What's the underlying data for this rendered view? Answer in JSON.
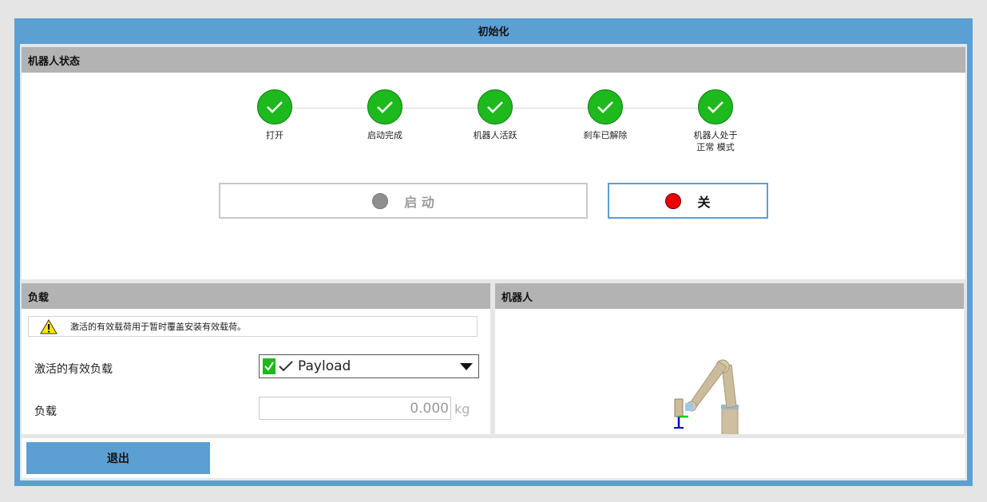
{
  "window": {
    "title": "初始化"
  },
  "robot_status": {
    "header": "机器人状态",
    "steps": [
      {
        "label": "打开"
      },
      {
        "label": "启动完成"
      },
      {
        "label": "机器人活跃"
      },
      {
        "label": "刹车已解除"
      },
      {
        "label": "机器人处于\n正常 模式"
      }
    ],
    "start_button": {
      "label": "启 动",
      "indicator_color": "#8f8f8f"
    },
    "off_button": {
      "label": "关",
      "indicator_color": "#ee0000"
    },
    "step_color": "#1db91d"
  },
  "payload": {
    "header": "负载",
    "warning": "激活的有效载荷用于暂时覆盖安装有效载荷。",
    "active_payload_label": "激活的有效负载",
    "active_payload_value": "Payload",
    "load_label": "负载",
    "load_value": "0.000",
    "load_unit": "kg"
  },
  "robot_view": {
    "header": "机器人"
  },
  "footer": {
    "exit_label": "退出"
  },
  "colors": {
    "accent": "#5b9fd3",
    "header_grey": "#b3b3b3"
  }
}
